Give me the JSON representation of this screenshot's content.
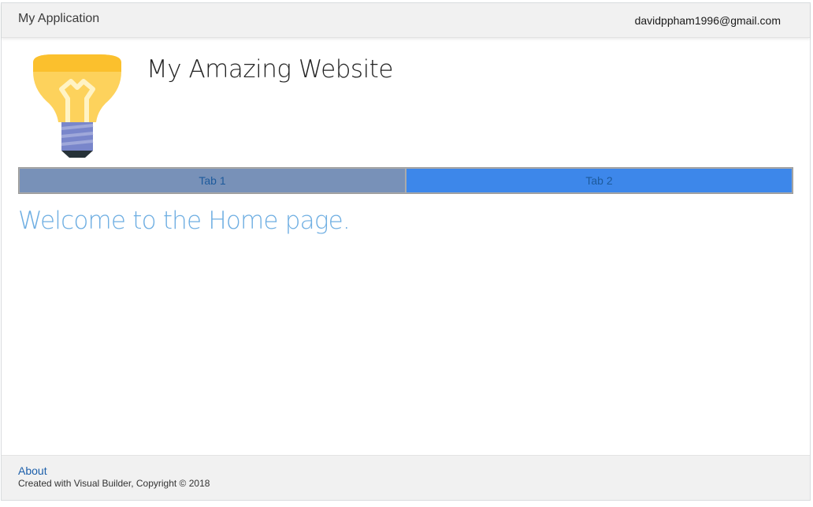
{
  "header": {
    "app_title": "My Application",
    "user_email": "davidppham1996@gmail.com"
  },
  "branding": {
    "logo_icon": "lightbulb-icon",
    "site_title": "My Amazing Website"
  },
  "tabs": [
    {
      "label": "Tab 1",
      "color": "#7891b8"
    },
    {
      "label": "Tab 2",
      "color": "#3d87ea"
    }
  ],
  "main": {
    "heading": "Welcome to the Home page."
  },
  "footer": {
    "about_label": "About",
    "copyright": "Created with Visual Builder, Copyright © 2018"
  },
  "colors": {
    "heading_accent": "#6eaee2",
    "link": "#1c5faa",
    "bulb_yellow": "#fdd25c",
    "bulb_base": "#7986cb"
  }
}
